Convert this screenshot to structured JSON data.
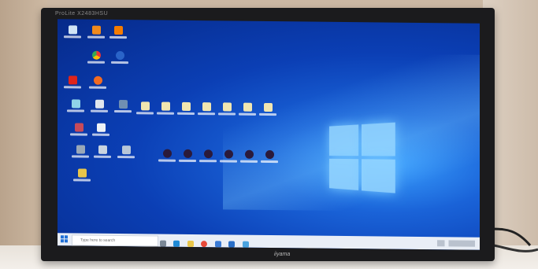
{
  "monitor": {
    "model_label": "ProLite X2483HSU",
    "brand": "iiyama"
  },
  "taskbar": {
    "search_placeholder": "Type here to search"
  }
}
